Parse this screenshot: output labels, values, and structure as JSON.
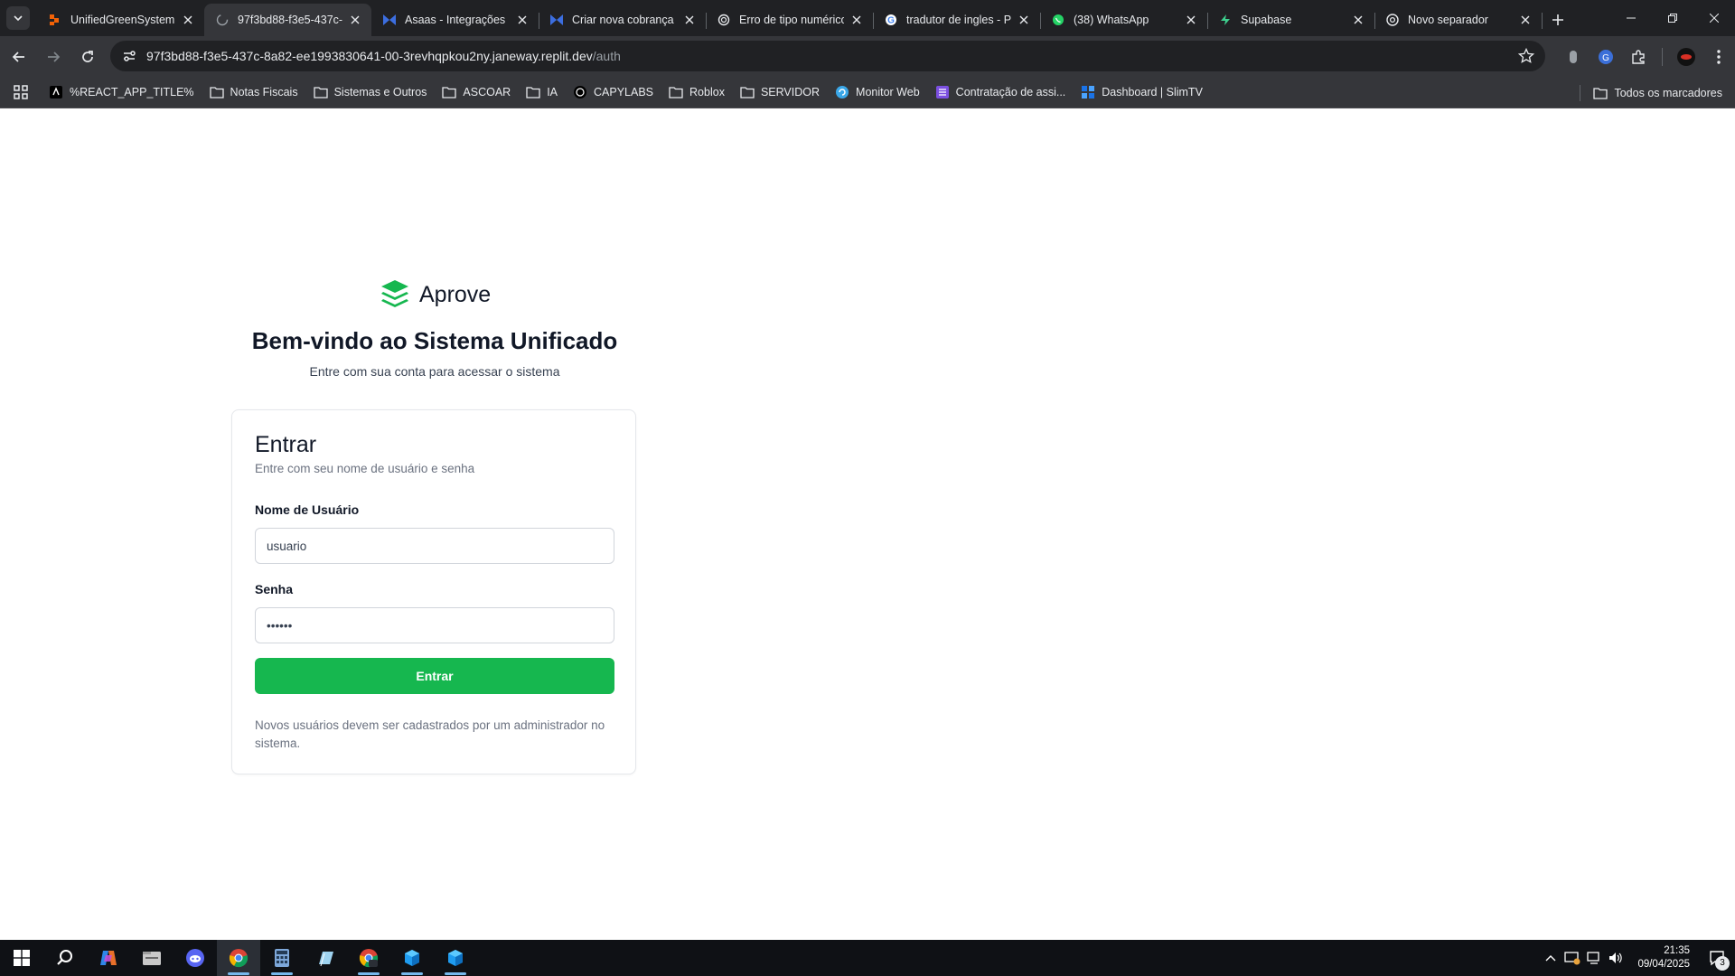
{
  "browser": {
    "tabs": [
      {
        "title": "UnifiedGreenSystem",
        "favicon": "replit-icon",
        "color": "#f26207",
        "active": false
      },
      {
        "title": "97f3bd88-f3e5-437c-8",
        "favicon": "loading-globe-icon",
        "color": "#9aa0a6",
        "active": true
      },
      {
        "title": "Asaas - Integrações",
        "favicon": "asaas-icon",
        "color": "#3c6ee0",
        "active": false
      },
      {
        "title": "Criar nova cobrança",
        "favicon": "asaas-icon",
        "color": "#3c6ee0",
        "active": false
      },
      {
        "title": "Erro de tipo numérico",
        "favicon": "chatgpt-icon",
        "color": "#e8eaed",
        "active": false
      },
      {
        "title": "tradutor de ingles - P",
        "favicon": "google-icon",
        "color": "#4285f4",
        "active": false
      },
      {
        "title": "(38) WhatsApp",
        "favicon": "whatsapp-icon",
        "color": "#25d366",
        "active": false
      },
      {
        "title": "Supabase",
        "favicon": "supabase-icon",
        "color": "#3ecf8e",
        "active": false
      },
      {
        "title": "Novo separador",
        "favicon": "chrome-icon",
        "color": "#e8eaed",
        "active": false
      }
    ],
    "url_host": "97f3bd88-f3e5-437c-8a82-ee1993830641-00-3revhqpkou2ny.janeway.replit.dev",
    "url_path": "/auth",
    "bookmarks": [
      {
        "label": "%REACT_APP_TITLE%",
        "icon": "react-app-icon"
      },
      {
        "label": "Notas Fiscais",
        "icon": "folder-icon"
      },
      {
        "label": "Sistemas e Outros",
        "icon": "folder-icon"
      },
      {
        "label": "ASCOAR",
        "icon": "folder-icon"
      },
      {
        "label": "IA",
        "icon": "folder-icon"
      },
      {
        "label": "CAPYLABS",
        "icon": "capylabs-icon"
      },
      {
        "label": "Roblox",
        "icon": "folder-icon"
      },
      {
        "label": "SERVIDOR",
        "icon": "folder-icon"
      },
      {
        "label": "Monitor Web",
        "icon": "monitor-web-icon"
      },
      {
        "label": "Contratação de assi...",
        "icon": "list-icon"
      },
      {
        "label": "Dashboard | SlimTV",
        "icon": "dashboard-icon"
      }
    ],
    "all_bookmarks": "Todos os marcadores"
  },
  "app": {
    "brand": "Aprove",
    "brand_color": "#16b74f",
    "welcome_title": "Bem-vindo ao Sistema Unificado",
    "welcome_subtitle": "Entre com sua conta para acessar o sistema",
    "login": {
      "title": "Entrar",
      "subtitle": "Entre com seu nome de usuário e senha",
      "username_label": "Nome de Usuário",
      "username_value": "usuario",
      "password_label": "Senha",
      "password_value": "••••••",
      "submit_label": "Entrar",
      "note": "Novos usuários devem ser cadastrados por um administrador no sistema."
    }
  },
  "taskbar": {
    "apps": [
      "windows-start-icon",
      "search-icon",
      "copilot-icon",
      "file-explorer-icon",
      "discord-icon",
      "chrome-icon",
      "calculator-icon",
      "notepad-icon",
      "chrome-profile-icon",
      "mongodb-compass-icon",
      "mongodb-compass-icon"
    ],
    "time": "21:35",
    "date": "09/04/2025",
    "notification_count": "3"
  }
}
